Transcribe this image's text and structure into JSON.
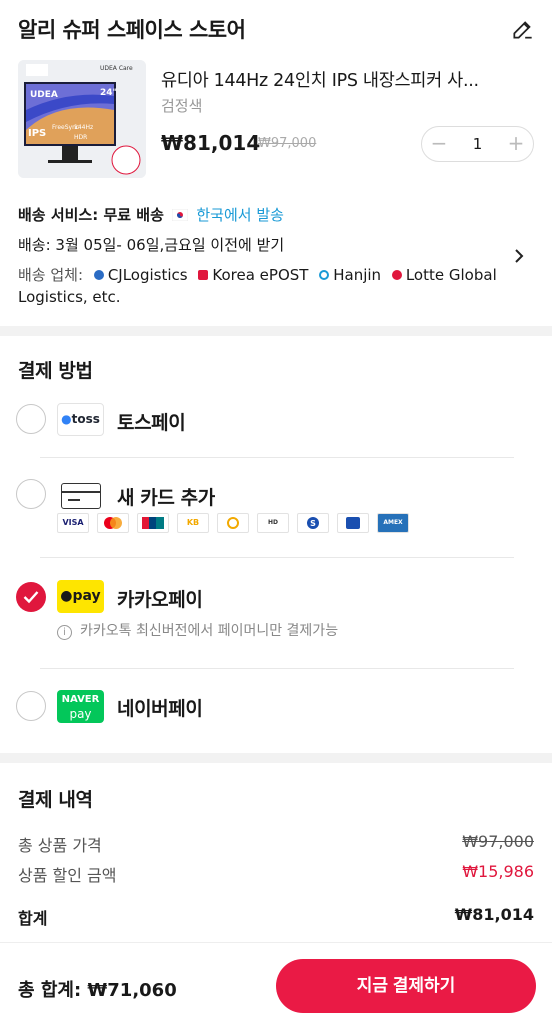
{
  "header": {
    "store_name": "알리 슈퍼 스페이스 스토어",
    "edit_icon": "pencil-icon"
  },
  "product": {
    "title": "유디아 144Hz 24인치 IPS 내장스피커 사...",
    "variant": "검정색",
    "price": "₩81,014",
    "original_price": "₩97,000",
    "quantity": "1",
    "thumbnail_text": {
      "brand": "UDEA",
      "brand_care": "UDEA Care",
      "size": "24\"",
      "panel": "IPS",
      "refresh": "144Hz",
      "freesync": "FreeSync",
      "hdr": "HDR"
    }
  },
  "shipping": {
    "service_label": "배송 서비스:",
    "service_value": "무료 배송",
    "origin": "한국에서 발송",
    "delivery": "배송: 3월 05일- 06일,금요일 이전에 받기",
    "carriers_label": "배송 업체:",
    "carriers": [
      {
        "name": "CJLogistics",
        "color": "#2b6cc4"
      },
      {
        "name": "Korea ePOST",
        "color": "#e0173d"
      },
      {
        "name": "Hanjin",
        "color": "#1a9ad6"
      },
      {
        "name": "Lotte",
        "color": "#e0173d"
      }
    ],
    "carriers_more": "Global Logistics, etc."
  },
  "payment": {
    "title": "결제 방법",
    "methods": [
      {
        "label": "토스페이",
        "logo_text": "toss",
        "selected": false
      },
      {
        "label": "새 카드 추가",
        "logo": "card-icon",
        "selected": false
      },
      {
        "label": "카카오페이",
        "logo_text": "pay",
        "selected": true
      },
      {
        "label": "네이버페이",
        "logo_text_top": "NAVER",
        "logo_text_bottom": "pay",
        "selected": false
      }
    ],
    "card_brands": [
      "VISA",
      "MC",
      "UnionPay",
      "KB",
      "NH",
      "HD",
      "S",
      "LOTTE",
      "AMEX"
    ],
    "kakao_note": "카카오톡 최신버전에서 페이머니만 결제가능"
  },
  "summary": {
    "title": "결제 내역",
    "rows": [
      {
        "label": "총 상품 가격",
        "value": "₩97,000"
      },
      {
        "label": "상품 할인 금액",
        "value": "₩15,986"
      }
    ],
    "total_label": "합계",
    "total_value": "₩81,014"
  },
  "footer": {
    "grand_total": "총 합계:  ₩71,060",
    "pay_button": "지금 결제하기"
  },
  "colors": {
    "accent": "#e0173d",
    "link": "#1a9ad6",
    "kakao": "#fee500",
    "naver": "#03c75a"
  }
}
